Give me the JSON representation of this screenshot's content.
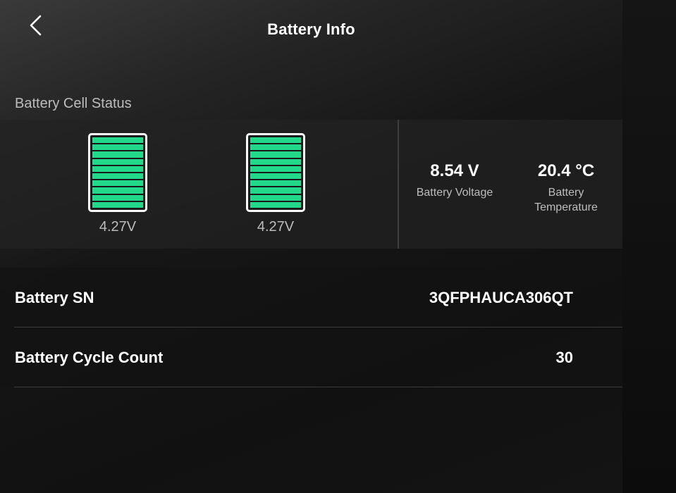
{
  "header": {
    "title": "Battery Info",
    "back_icon": "chevron-left-icon"
  },
  "cell_status": {
    "title": "Battery Cell Status",
    "fill_color": "#22d88a",
    "cells": [
      {
        "voltage": "4.27V",
        "level": 1.0
      },
      {
        "voltage": "4.27V",
        "level": 1.0
      }
    ]
  },
  "stats": {
    "voltage": {
      "value": "8.54 V",
      "label": "Battery Voltage"
    },
    "temperature": {
      "value": "20.4 °C",
      "label_line1": "Battery",
      "label_line2": "Temperature"
    }
  },
  "details": {
    "serial": {
      "label": "Battery SN",
      "value": "3QFPHAUCA306QT"
    },
    "cycles": {
      "label": "Battery Cycle Count",
      "value": "30"
    }
  }
}
